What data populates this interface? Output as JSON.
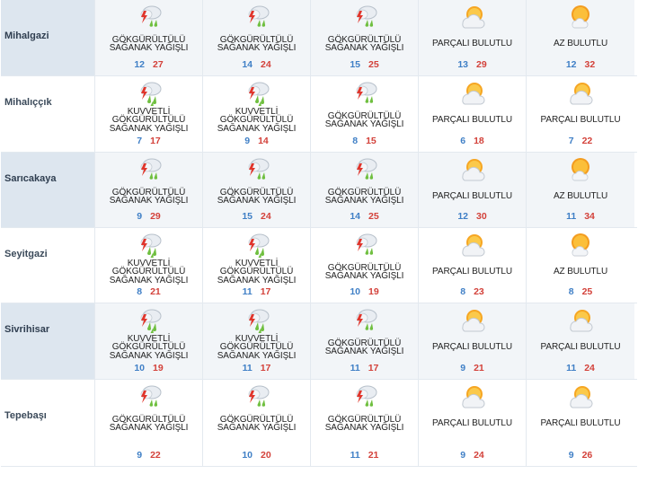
{
  "rows": [
    {
      "city": "Mihalgazi",
      "shaded": true,
      "days": [
        {
          "icon": "thunderstorm-icon",
          "heavy": false,
          "desc": [
            "GÖKGÜRÜLTÜLÜ",
            "SAĞANAK YAĞIŞLI"
          ],
          "min": "12",
          "max": "27"
        },
        {
          "icon": "thunderstorm-icon",
          "heavy": false,
          "desc": [
            "GÖKGÜRÜLTÜLÜ",
            "SAĞANAK YAĞIŞLI"
          ],
          "min": "14",
          "max": "24"
        },
        {
          "icon": "thunderstorm-icon",
          "heavy": false,
          "desc": [
            "GÖKGÜRÜLTÜLÜ",
            "SAĞANAK YAĞIŞLI"
          ],
          "min": "15",
          "max": "25"
        },
        {
          "icon": "partly-cloudy-icon",
          "desc": [
            "PARÇALI BULUTLU"
          ],
          "min": "13",
          "max": "29"
        },
        {
          "icon": "mostly-sunny-icon",
          "desc": [
            "AZ BULUTLU"
          ],
          "min": "12",
          "max": "32"
        }
      ]
    },
    {
      "city": "Mihalıççık",
      "shaded": false,
      "days": [
        {
          "icon": "heavy-thunderstorm-icon",
          "heavy": true,
          "desc": [
            "KUVVETLİ",
            "GÖKGÜRÜLTÜLÜ",
            "SAĞANAK YAĞIŞLI"
          ],
          "min": "7",
          "max": "17"
        },
        {
          "icon": "heavy-thunderstorm-icon",
          "heavy": true,
          "desc": [
            "KUVVETLİ",
            "GÖKGÜRÜLTÜLÜ",
            "SAĞANAK YAĞIŞLI"
          ],
          "min": "9",
          "max": "14"
        },
        {
          "icon": "thunderstorm-icon",
          "heavy": false,
          "desc": [
            "GÖKGÜRÜLTÜLÜ",
            "SAĞANAK YAĞIŞLI"
          ],
          "min": "8",
          "max": "15"
        },
        {
          "icon": "partly-cloudy-icon",
          "desc": [
            "PARÇALI BULUTLU"
          ],
          "min": "6",
          "max": "18"
        },
        {
          "icon": "partly-cloudy-icon",
          "desc": [
            "PARÇALI BULUTLU"
          ],
          "min": "7",
          "max": "22"
        }
      ]
    },
    {
      "city": "Sarıcakaya",
      "shaded": true,
      "days": [
        {
          "icon": "thunderstorm-icon",
          "heavy": false,
          "desc": [
            "GÖKGÜRÜLTÜLÜ",
            "SAĞANAK YAĞIŞLI"
          ],
          "min": "9",
          "max": "29"
        },
        {
          "icon": "thunderstorm-icon",
          "heavy": false,
          "desc": [
            "GÖKGÜRÜLTÜLÜ",
            "SAĞANAK YAĞIŞLI"
          ],
          "min": "15",
          "max": "24"
        },
        {
          "icon": "thunderstorm-icon",
          "heavy": false,
          "desc": [
            "GÖKGÜRÜLTÜLÜ",
            "SAĞANAK YAĞIŞLI"
          ],
          "min": "14",
          "max": "25"
        },
        {
          "icon": "partly-cloudy-icon",
          "desc": [
            "PARÇALI BULUTLU"
          ],
          "min": "12",
          "max": "30"
        },
        {
          "icon": "mostly-sunny-icon",
          "desc": [
            "AZ BULUTLU"
          ],
          "min": "11",
          "max": "34"
        }
      ]
    },
    {
      "city": "Seyitgazi",
      "shaded": false,
      "days": [
        {
          "icon": "heavy-thunderstorm-icon",
          "heavy": true,
          "desc": [
            "KUVVETLİ",
            "GÖKGÜRÜLTÜLÜ",
            "SAĞANAK YAĞIŞLI"
          ],
          "min": "8",
          "max": "21"
        },
        {
          "icon": "heavy-thunderstorm-icon",
          "heavy": true,
          "desc": [
            "KUVVETLİ",
            "GÖKGÜRÜLTÜLÜ",
            "SAĞANAK YAĞIŞLI"
          ],
          "min": "11",
          "max": "17"
        },
        {
          "icon": "thunderstorm-icon",
          "heavy": false,
          "desc": [
            "GÖKGÜRÜLTÜLÜ",
            "SAĞANAK YAĞIŞLI"
          ],
          "min": "10",
          "max": "19"
        },
        {
          "icon": "partly-cloudy-icon",
          "desc": [
            "PARÇALI BULUTLU"
          ],
          "min": "8",
          "max": "23"
        },
        {
          "icon": "mostly-sunny-icon",
          "desc": [
            "AZ BULUTLU"
          ],
          "min": "8",
          "max": "25"
        }
      ]
    },
    {
      "city": "Sivrihisar",
      "shaded": true,
      "days": [
        {
          "icon": "heavy-thunderstorm-icon",
          "heavy": true,
          "desc": [
            "KUVVETLİ",
            "GÖKGÜRÜLTÜLÜ",
            "SAĞANAK YAĞIŞLI"
          ],
          "min": "10",
          "max": "19"
        },
        {
          "icon": "heavy-thunderstorm-icon",
          "heavy": true,
          "desc": [
            "KUVVETLİ",
            "GÖKGÜRÜLTÜLÜ",
            "SAĞANAK YAĞIŞLI"
          ],
          "min": "11",
          "max": "17"
        },
        {
          "icon": "thunderstorm-icon",
          "heavy": false,
          "desc": [
            "GÖKGÜRÜLTÜLÜ",
            "SAĞANAK YAĞIŞLI"
          ],
          "min": "11",
          "max": "17"
        },
        {
          "icon": "partly-cloudy-icon",
          "desc": [
            "PARÇALI BULUTLU"
          ],
          "min": "9",
          "max": "21"
        },
        {
          "icon": "partly-cloudy-icon",
          "desc": [
            "PARÇALI BULUTLU"
          ],
          "min": "11",
          "max": "24"
        }
      ]
    },
    {
      "city": "Tepebaşı",
      "shaded": false,
      "days": [
        {
          "icon": "thunderstorm-icon",
          "heavy": false,
          "desc": [
            "GÖKGÜRÜLTÜLÜ",
            "SAĞANAK YAĞIŞLI"
          ],
          "min": "9",
          "max": "22"
        },
        {
          "icon": "thunderstorm-icon",
          "heavy": false,
          "desc": [
            "GÖKGÜRÜLTÜLÜ",
            "SAĞANAK YAĞIŞLI"
          ],
          "min": "10",
          "max": "20"
        },
        {
          "icon": "thunderstorm-icon",
          "heavy": false,
          "desc": [
            "GÖKGÜRÜLTÜLÜ",
            "SAĞANAK YAĞIŞLI"
          ],
          "min": "11",
          "max": "21"
        },
        {
          "icon": "partly-cloudy-icon",
          "desc": [
            "PARÇALI BULUTLU"
          ],
          "min": "9",
          "max": "24"
        },
        {
          "icon": "partly-cloudy-icon",
          "desc": [
            "PARÇALI BULUTLU"
          ],
          "min": "9",
          "max": "26"
        }
      ]
    }
  ],
  "colors": {
    "min_temp": "#3f7fc6",
    "max_temp": "#d3413a",
    "shaded_city": "#dde6ef",
    "shaded_cell": "#f2f5f8"
  }
}
